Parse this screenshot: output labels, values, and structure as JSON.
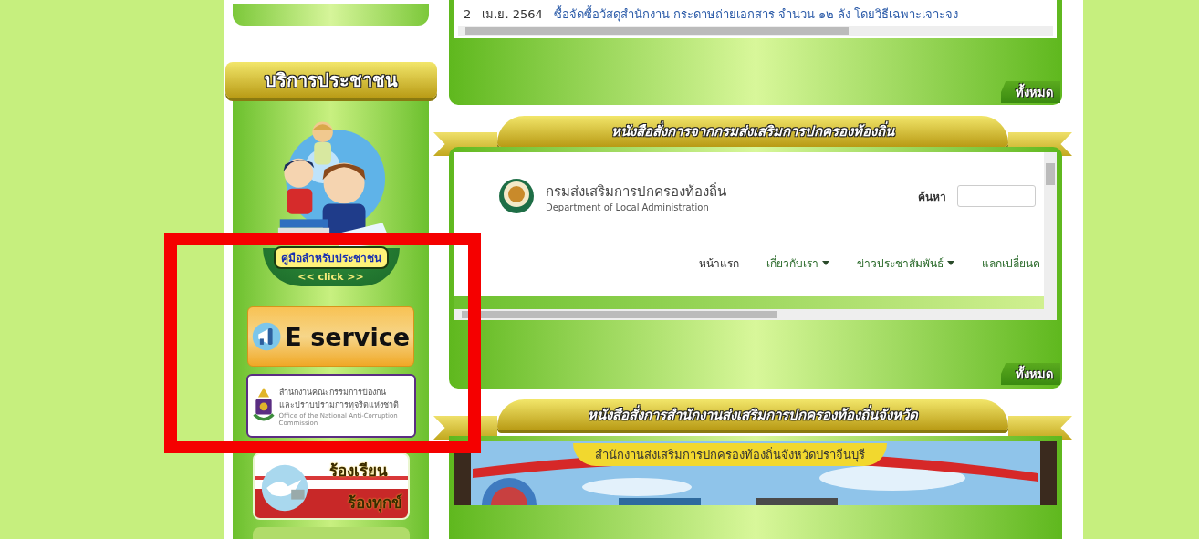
{
  "sidebar": {
    "title": "บริการประชาชน",
    "guide": {
      "label": "คู่มือสำหรับประชาชน",
      "click": "<< click >>"
    },
    "eservice": {
      "label": "E service"
    },
    "nacc": {
      "line1": "สำนักงานคณะกรรมการป้องกัน",
      "line2": "และปราบปรามการทุจริตแห่งชาติ",
      "english": "Office of the National Anti-Corruption Commission"
    },
    "complaint": {
      "line1": "ร้องเรียน",
      "line2": "ร้องทุกข์"
    }
  },
  "news_panel": {
    "rows": [
      {
        "number": "2",
        "date": "เม.ย. 2564",
        "title": "ซื้อจัดซื้อวัสดุสำนักงาน กระดาษถ่ายเอกสาร จำนวน ๑๒ ลัง โดยวิธีเฉพาะเจาะจง"
      }
    ],
    "more": "ทั้งหมด"
  },
  "sections": [
    {
      "title": "หนังสือสั่งการจากกรมส่งเสริมการปกครองท้องถิ่น",
      "kind": "site",
      "site": {
        "name": "กรมส่งเสริมการปกครองท้องถิ่น",
        "english": "Department of Local Administration",
        "search_label": "ค้นหา",
        "nav": [
          {
            "label": "หน้าแรก",
            "dropdown": false
          },
          {
            "label": "เกี่ยวกับเรา",
            "dropdown": true
          },
          {
            "label": "ข่าวประชาสัมพันธ์",
            "dropdown": true
          },
          {
            "label": "แลกเปลี่ยนค",
            "dropdown": false
          }
        ]
      },
      "more": "ทั้งหมด"
    },
    {
      "title": "หนังสือสั่งการสำนักงานส่งเสริมการปกครองท้องถิ่นจังหวัด",
      "kind": "banner",
      "banner": "สำนักงานส่งเสริมการปกครองท้องถิ่นจังหวัดปราจีนบุรี"
    }
  ],
  "annotation": {
    "kind": "highlight-box"
  }
}
